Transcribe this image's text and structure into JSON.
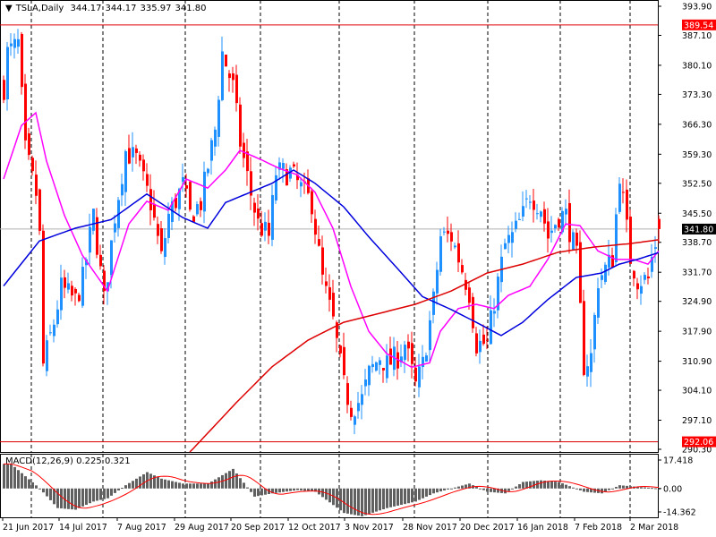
{
  "header": {
    "symbol": "TSLA,Daily",
    "open": "344.17",
    "high": "344.17",
    "low": "335.97",
    "close": "341.80"
  },
  "macd_header": {
    "label": "MACD(12,26,9)",
    "main": "0.225",
    "signal": "0.321"
  },
  "colors": {
    "bull": "#1e90ff",
    "bear": "#ff0000",
    "ma_fast": "#ff00ff",
    "ma_mid": "#0000dd",
    "ma_slow": "#dd0000",
    "hist": "#606060",
    "level_line": "#dd0000"
  },
  "chart_data": {
    "type": "candlestick",
    "ylim": [
      290.3,
      393.9
    ],
    "price_ticks": [
      "393.90",
      "387.10",
      "380.10",
      "373.30",
      "366.30",
      "359.30",
      "352.50",
      "345.50",
      "338.70",
      "331.70",
      "324.90",
      "317.90",
      "310.90",
      "304.10",
      "297.10",
      "290.30"
    ],
    "level_lines": [
      {
        "value": "389.54"
      },
      {
        "value": "292.06"
      }
    ],
    "current_price": "341.80",
    "date_ticks": [
      "21 Jun 2017",
      "14 Jul 2017",
      "7 Aug 2017",
      "29 Aug 2017",
      "20 Sep 2017",
      "12 Oct 2017",
      "3 Nov 2017",
      "28 Nov 2017",
      "20 Dec 2017",
      "16 Jan 2018",
      "7 Feb 2018",
      "2 Mar 2018"
    ],
    "bars": 184,
    "close_keypoints": [
      [
        0,
        375
      ],
      [
        1,
        383
      ],
      [
        4,
        385
      ],
      [
        6,
        360
      ],
      [
        9,
        350
      ],
      [
        10,
        340
      ],
      [
        11,
        310
      ],
      [
        14,
        320
      ],
      [
        16,
        328
      ],
      [
        20,
        325
      ],
      [
        22,
        330
      ],
      [
        25,
        345
      ],
      [
        28,
        325
      ],
      [
        31,
        345
      ],
      [
        34,
        360
      ],
      [
        37,
        358
      ],
      [
        41,
        348
      ],
      [
        44,
        335
      ],
      [
        46,
        345
      ],
      [
        50,
        352
      ],
      [
        52,
        345
      ],
      [
        55,
        348
      ],
      [
        59,
        365
      ],
      [
        61,
        383
      ],
      [
        64,
        375
      ],
      [
        66,
        362
      ],
      [
        69,
        350
      ],
      [
        71,
        343
      ],
      [
        74,
        340
      ],
      [
        76,
        355
      ],
      [
        80,
        355
      ],
      [
        84,
        350
      ],
      [
        86,
        348
      ],
      [
        89,
        330
      ],
      [
        92,
        320
      ],
      [
        95,
        305
      ],
      [
        97,
        300
      ],
      [
        100,
        302
      ],
      [
        102,
        308
      ],
      [
        105,
        312
      ],
      [
        107,
        310
      ],
      [
        110,
        312
      ],
      [
        112,
        315
      ],
      [
        115,
        305
      ],
      [
        117,
        310
      ],
      [
        120,
        325
      ],
      [
        122,
        340
      ],
      [
        125,
        340
      ],
      [
        127,
        335
      ],
      [
        130,
        327
      ],
      [
        132,
        315
      ],
      [
        135,
        315
      ],
      [
        137,
        325
      ],
      [
        140,
        338
      ],
      [
        142,
        340
      ],
      [
        145,
        345
      ],
      [
        147,
        350
      ],
      [
        150,
        347
      ],
      [
        152,
        340
      ],
      [
        155,
        345
      ],
      [
        157,
        345
      ],
      [
        160,
        335
      ],
      [
        162,
        310
      ],
      [
        164,
        312
      ],
      [
        166,
        330
      ],
      [
        170,
        335
      ],
      [
        172,
        355
      ],
      [
        175,
        335
      ],
      [
        177,
        330
      ],
      [
        180,
        330
      ],
      [
        181,
        335
      ],
      [
        183,
        341.8
      ]
    ],
    "ma_fast_keypoints": [
      [
        0,
        353.5
      ],
      [
        5,
        366
      ],
      [
        9,
        369
      ],
      [
        12,
        357.7
      ],
      [
        17,
        345
      ],
      [
        22,
        335.7
      ],
      [
        29,
        327.3
      ],
      [
        35,
        343
      ],
      [
        40,
        348.3
      ],
      [
        46,
        346.2
      ],
      [
        51,
        353.5
      ],
      [
        57,
        351.4
      ],
      [
        62,
        355.6
      ],
      [
        66,
        360.2
      ],
      [
        72,
        358
      ],
      [
        77,
        356
      ],
      [
        82,
        354.5
      ],
      [
        87,
        350.4
      ],
      [
        92,
        342
      ],
      [
        97,
        328.4
      ],
      [
        102,
        317.9
      ],
      [
        107,
        312.7
      ],
      [
        114,
        309.5
      ],
      [
        119,
        310.5
      ],
      [
        122,
        317.9
      ],
      [
        127,
        323.2
      ],
      [
        132,
        324.2
      ],
      [
        137,
        323.2
      ],
      [
        141,
        326.3
      ],
      [
        147,
        328.4
      ],
      [
        152,
        334.7
      ],
      [
        157,
        343
      ],
      [
        161,
        342.6
      ],
      [
        166,
        336.7
      ],
      [
        171,
        334.7
      ],
      [
        176,
        334.7
      ],
      [
        180,
        333.6
      ],
      [
        183,
        336.7
      ]
    ],
    "ma_mid_keypoints": [
      [
        0,
        328.5
      ],
      [
        10,
        339
      ],
      [
        20,
        342
      ],
      [
        30,
        344
      ],
      [
        40,
        350
      ],
      [
        50,
        344.5
      ],
      [
        57,
        342
      ],
      [
        62,
        348
      ],
      [
        75,
        352.5
      ],
      [
        81,
        355.6
      ],
      [
        87,
        352.5
      ],
      [
        95,
        347
      ],
      [
        102,
        340
      ],
      [
        110,
        332.6
      ],
      [
        117,
        326
      ],
      [
        125,
        323
      ],
      [
        132,
        320
      ],
      [
        139,
        316.9
      ],
      [
        145,
        320
      ],
      [
        152,
        325.3
      ],
      [
        160,
        330.5
      ],
      [
        167,
        331.5
      ],
      [
        172,
        333.6
      ],
      [
        177,
        334.7
      ],
      [
        183,
        336.3
      ]
    ],
    "ma_slow_keypoints": [
      [
        52,
        289.6
      ],
      [
        65,
        301.2
      ],
      [
        75,
        309.6
      ],
      [
        85,
        315.8
      ],
      [
        95,
        320
      ],
      [
        105,
        322.1
      ],
      [
        115,
        324.2
      ],
      [
        125,
        327.3
      ],
      [
        135,
        331.5
      ],
      [
        145,
        333.6
      ],
      [
        155,
        336.4
      ],
      [
        165,
        337.6
      ],
      [
        175,
        338.4
      ],
      [
        183,
        339.3
      ]
    ],
    "macd_ylim": [
      -14.362,
      17.418
    ],
    "macd_ticks": [
      "17.418",
      "0.00",
      "-14.362"
    ],
    "macd_keypoints": [
      [
        0,
        15
      ],
      [
        2,
        15
      ],
      [
        10,
        0
      ],
      [
        15,
        -12
      ],
      [
        20,
        -13
      ],
      [
        25,
        -8
      ],
      [
        29,
        -6
      ],
      [
        34,
        2
      ],
      [
        40,
        10
      ],
      [
        44,
        6
      ],
      [
        50,
        3
      ],
      [
        57,
        3
      ],
      [
        64,
        12
      ],
      [
        70,
        -5
      ],
      [
        75,
        -3
      ],
      [
        82,
        -1
      ],
      [
        87,
        -2
      ],
      [
        95,
        -15
      ],
      [
        100,
        -17
      ],
      [
        107,
        -12
      ],
      [
        115,
        -8
      ],
      [
        120,
        -3
      ],
      [
        125,
        0
      ],
      [
        130,
        3
      ],
      [
        135,
        -2
      ],
      [
        140,
        -3
      ],
      [
        145,
        4
      ],
      [
        150,
        5
      ],
      [
        155,
        4
      ],
      [
        162,
        -2
      ],
      [
        167,
        -3
      ],
      [
        172,
        2
      ],
      [
        177,
        1
      ],
      [
        183,
        0
      ]
    ]
  }
}
